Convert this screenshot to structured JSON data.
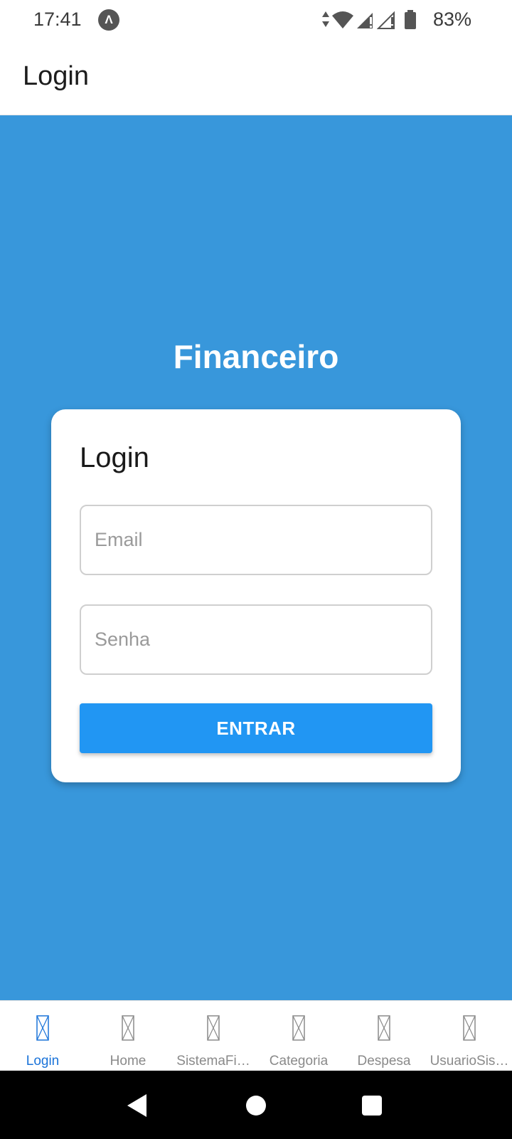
{
  "status_bar": {
    "time": "17:41",
    "app_icon_glyph": "Λ",
    "battery_percent": "83%"
  },
  "header": {
    "title": "Login"
  },
  "main": {
    "brand_title": "Financeiro",
    "card": {
      "title": "Login",
      "email": {
        "placeholder": "Email",
        "value": ""
      },
      "senha": {
        "placeholder": "Senha",
        "value": ""
      },
      "submit_label": "ENTRAR"
    }
  },
  "tabs": [
    {
      "label": "Login",
      "active": true
    },
    {
      "label": "Home",
      "active": false
    },
    {
      "label": "SistemaFi…",
      "active": false
    },
    {
      "label": "Categoria",
      "active": false
    },
    {
      "label": "Despesa",
      "active": false
    },
    {
      "label": "UsuarioSis…",
      "active": false
    }
  ],
  "colors": {
    "background_blue": "#3897db",
    "button_blue": "#2196f3",
    "active_tab": "#1a73d9",
    "inactive_tab": "#8a8a8a"
  },
  "icons": {
    "tab_icon": "missing-glyph-icon",
    "status": [
      "data-arrows-icon",
      "wifi-icon",
      "signal-icon",
      "signal-no-service-icon",
      "battery-icon"
    ],
    "nav": [
      "back-icon",
      "home-icon",
      "recents-icon"
    ]
  }
}
